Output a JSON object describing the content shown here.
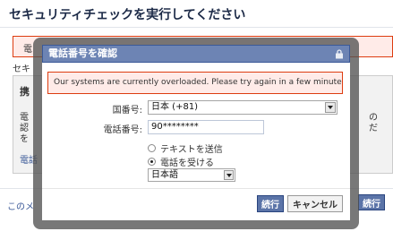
{
  "background": {
    "title": "セキュリティチェックを実行してください",
    "alert_fragment": "電",
    "under_alert_fragment": "セキ",
    "section_heading": "携",
    "section_body_lines": [
      "電",
      "認",
      "を"
    ],
    "section_right_fragment_lines": [
      "の",
      "だ"
    ],
    "section_link": "電話",
    "footer_link": "このメ",
    "continue_button": "続行"
  },
  "dialog": {
    "title": "電話番号を確認",
    "error_message": "Our systems are currently overloaded. Please try again in a few minutes.",
    "country_label": "国番号:",
    "country_value": "日本 (+81)",
    "phone_label": "電話番号:",
    "phone_value": "90********",
    "option_sms": "テキストを送信",
    "option_call": "電話を受ける",
    "selected_option": "call",
    "language_value": "日本語",
    "continue_button": "続行",
    "cancel_button": "キャンセル"
  },
  "colors": {
    "header_blue": "#6d84b4",
    "button_blue": "#5b74a8",
    "error_bg": "#ffebe8",
    "error_border": "#dd3c10"
  }
}
